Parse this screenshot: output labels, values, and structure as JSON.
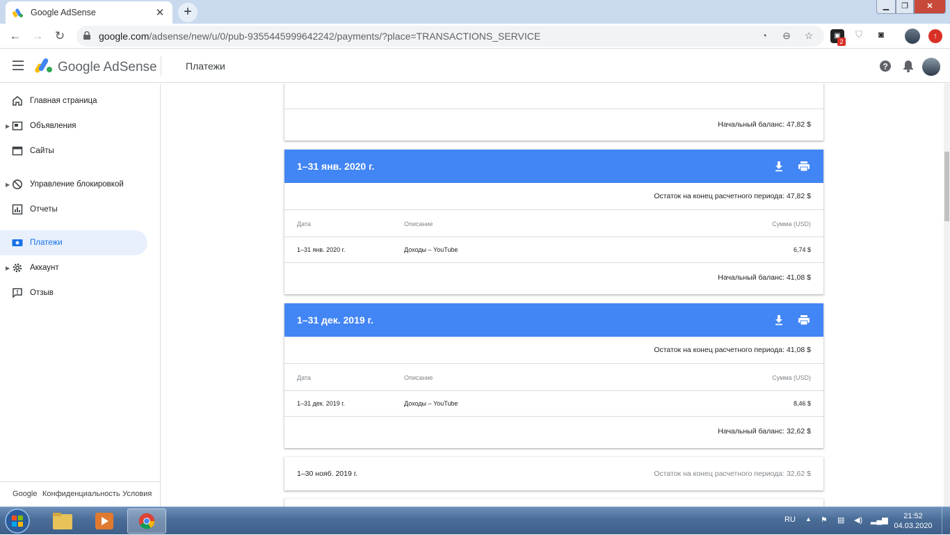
{
  "browser": {
    "tab_title": "Google AdSense",
    "tab_close": "✕",
    "new_tab": "+",
    "url_host": "google.com",
    "url_path": "/adsense/new/u/0/pub-9355445999642242/payments/?place=TRANSACTIONS_SERVICE",
    "extension_badge": "2"
  },
  "app": {
    "brand": "Google AdSense",
    "page_title": "Платежи"
  },
  "sidebar": {
    "items": [
      {
        "label": "Главная страница",
        "icon": "home-icon"
      },
      {
        "label": "Объявления",
        "icon": "ads-icon"
      },
      {
        "label": "Сайты",
        "icon": "sites-icon"
      },
      {
        "label": "Управление блокировкой",
        "icon": "block-icon"
      },
      {
        "label": "Отчеты",
        "icon": "reports-icon"
      },
      {
        "label": "Платежи",
        "icon": "payments-icon"
      },
      {
        "label": "Аккаунт",
        "icon": "gear-icon"
      },
      {
        "label": "Отзыв",
        "icon": "feedback-icon"
      }
    ],
    "footer": {
      "google": "Google",
      "privacy": "Конфиденциальность",
      "terms": "Условия"
    }
  },
  "payments": {
    "top_card_opening": "Начальный баланс: 47,82 $",
    "columns": {
      "date": "Дата",
      "description": "Описание",
      "amount": "Сумма (USD)"
    },
    "periods": [
      {
        "period": "1–31 янв. 2020 г.",
        "closing": "Остаток на конец расчетного периода: 47,82 $",
        "rows": [
          {
            "date": "1–31 янв. 2020 г.",
            "description": "Доходы – YouTube",
            "amount": "6,74 $"
          }
        ],
        "opening": "Начальный баланс: 41,08 $"
      },
      {
        "period": "1–31 дек. 2019 г.",
        "closing": "Остаток на конец расчетного периода: 41,08 $",
        "rows": [
          {
            "date": "1–31 дек. 2019 г.",
            "description": "Доходы – YouTube",
            "amount": "8,46 $"
          }
        ],
        "opening": "Начальный баланс: 32,62 $"
      }
    ],
    "collapsed": {
      "period": "1–30 нояб. 2019 г.",
      "closing": "Остаток на конец расчетного периода: 32,62 $"
    }
  },
  "taskbar": {
    "lang": "RU",
    "time": "21:52",
    "date": "04.03.2020"
  },
  "colors": {
    "accent": "#4285f4",
    "active_nav": "#1a73e8"
  }
}
